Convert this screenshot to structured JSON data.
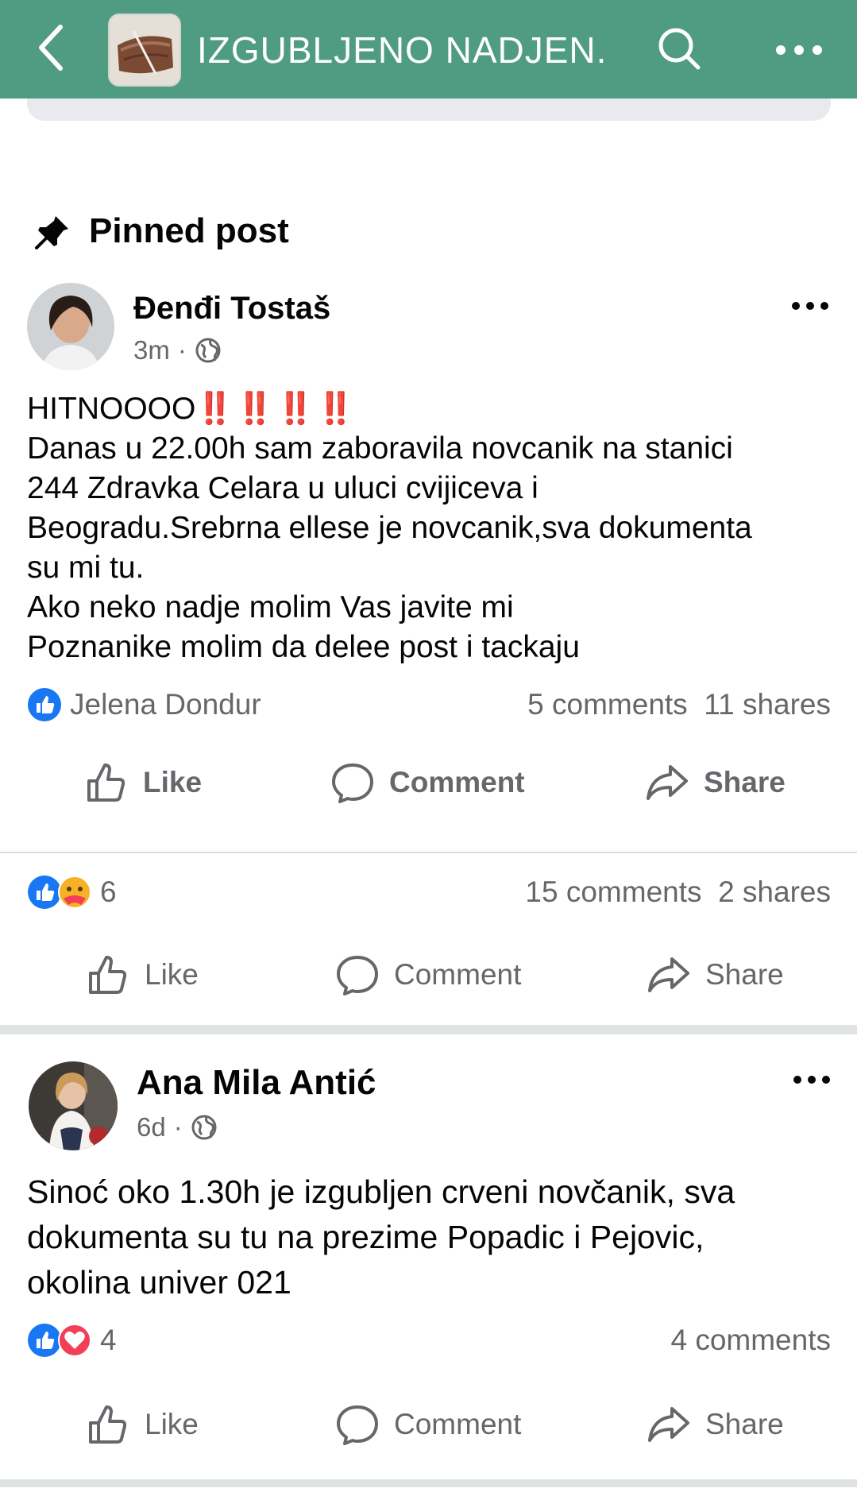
{
  "header": {
    "title": "IZGUBLJENO NADJEN...",
    "bg_color": "#509c82"
  },
  "pinned_label": "Pinned post",
  "posts": [
    {
      "author": "Đenđi Tostaš",
      "time": "3m",
      "visibility_icon": "globe-icon",
      "lines": [
        "HITNOOOO",
        "Danas u 22.00h sam zaboravila novcanik na stanici",
        "244 Zdravka Celara u uluci cvijiceva i",
        "Beogradu.Srebrna ellese je novcanik,sva dokumenta",
        "su mi tu.",
        "Ako neko nadje molim Vas javite mi",
        "Poznanike molim da delee post i tackaju"
      ],
      "urgent_marks": "‼️‼️‼️‼️",
      "liked_by": "Jelena Dondur",
      "comments": "5 comments",
      "shares": "11 shares"
    },
    {
      "reactions_count": "6",
      "comments": "15 comments",
      "shares": "2 shares"
    },
    {
      "author": "Ana Mila Antić",
      "time": "6d",
      "visibility_icon": "globe-icon",
      "lines": [
        "Sinoć oko 1.30h je izgubljen crveni novčanik, sva",
        "dokumenta su tu na prezime Popadic i Pejovic,",
        "okolina univer 021"
      ],
      "reactions_count": "4",
      "comments": "4 comments"
    }
  ],
  "actions": {
    "like": "Like",
    "comment": "Comment",
    "share": "Share"
  },
  "colors": {
    "like_blue": "#1877f2",
    "love_red": "#f33e58",
    "care_yellow": "#f7b125",
    "urgent_red": "#e8322e",
    "secondary_text": "#65676b"
  }
}
